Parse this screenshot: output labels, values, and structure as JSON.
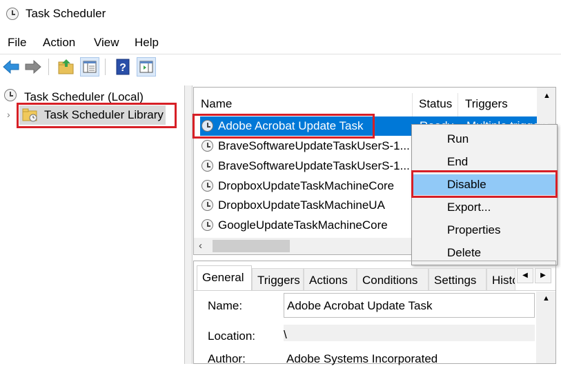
{
  "window": {
    "title": "Task Scheduler"
  },
  "menu": {
    "items": [
      "File",
      "Action",
      "View",
      "Help"
    ]
  },
  "tree": {
    "root": "Task Scheduler (Local)",
    "library": "Task Scheduler Library"
  },
  "task_list": {
    "columns": [
      "Name",
      "Status",
      "Triggers"
    ],
    "selected_status_partial": "Ready",
    "selected_triggers_partial": "Multiple triggers",
    "rows": [
      "Adobe Acrobat Update Task",
      "BraveSoftwareUpdateTaskUserS-1...",
      "BraveSoftwareUpdateTaskUserS-1...",
      "DropboxUpdateTaskMachineCore",
      "DropboxUpdateTaskMachineUA",
      "GoogleUpdateTaskMachineCore"
    ]
  },
  "context_menu": {
    "items": [
      "Run",
      "End",
      "Disable",
      "Export...",
      "Properties",
      "Delete"
    ],
    "highlighted": "Disable"
  },
  "details": {
    "tabs": [
      "General",
      "Triggers",
      "Actions",
      "Conditions",
      "Settings",
      "Histo"
    ],
    "active_tab": "General",
    "name_label": "Name:",
    "name_value": "Adobe Acrobat Update Task",
    "location_label": "Location:",
    "location_value": "\\",
    "author_label": "Author:",
    "author_value": "Adobe Systems Incorporated"
  },
  "colors": {
    "selection": "#0078d7",
    "highlight_box": "#d71f26",
    "menu_highlight": "#91c9f7"
  }
}
